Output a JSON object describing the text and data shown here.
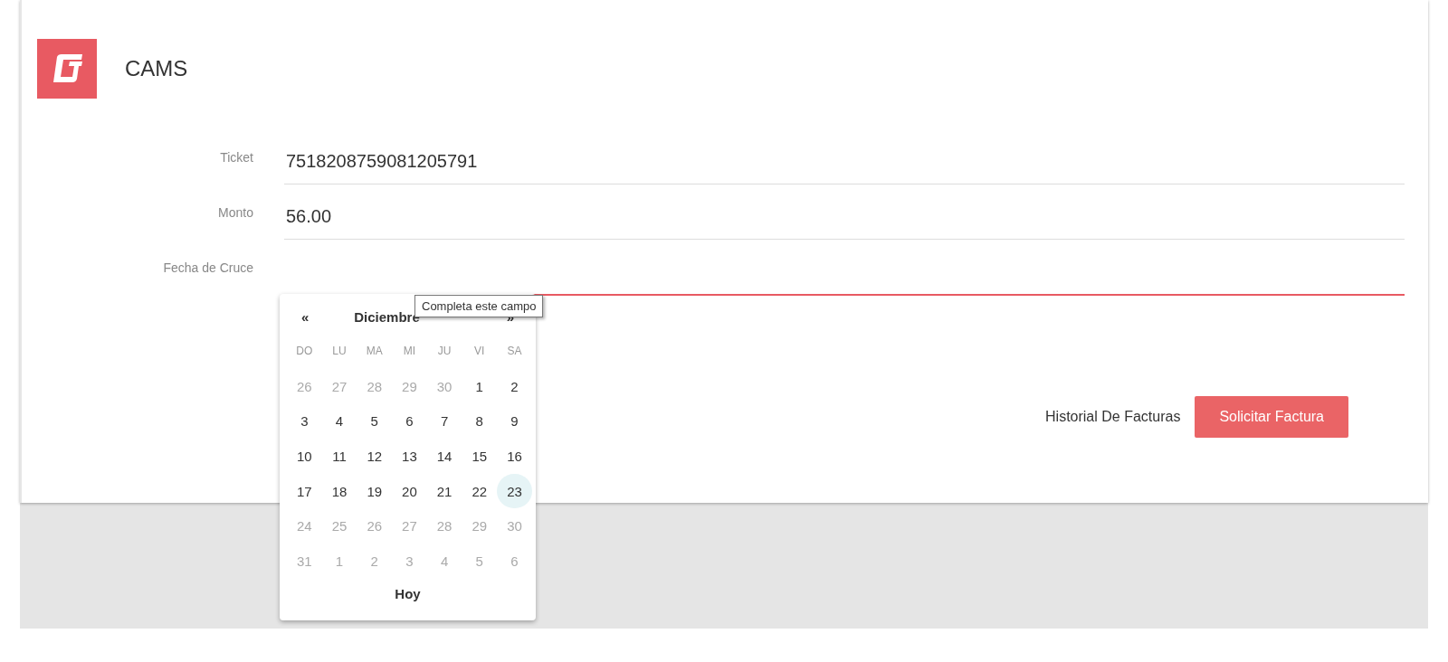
{
  "header": {
    "title": "CAMS"
  },
  "fields": [
    {
      "label": "Ticket",
      "value": "7518208759081205791",
      "invalid": false
    },
    {
      "label": "Monto",
      "value": "56.00",
      "invalid": false
    },
    {
      "label": "Fecha de Cruce",
      "invalid": true
    }
  ],
  "tooltip": "Completa este campo",
  "calendar": {
    "prev": "«",
    "title": "Diciembre",
    "next": "»",
    "weekdays": [
      "DO",
      "LU",
      "MA",
      "MI",
      "JU",
      "VI",
      "SA"
    ],
    "weeks": [
      [
        {
          "day": "26",
          "muted": true,
          "selected": false
        },
        {
          "day": "27",
          "muted": true,
          "selected": false
        },
        {
          "day": "28",
          "muted": true,
          "selected": false
        },
        {
          "day": "29",
          "muted": true,
          "selected": false
        },
        {
          "day": "30",
          "muted": true,
          "selected": false
        },
        {
          "day": "1",
          "muted": false,
          "selected": false
        },
        {
          "day": "2",
          "muted": false,
          "selected": false
        }
      ],
      [
        {
          "day": "3",
          "muted": false,
          "selected": false
        },
        {
          "day": "4",
          "muted": false,
          "selected": false
        },
        {
          "day": "5",
          "muted": false,
          "selected": false
        },
        {
          "day": "6",
          "muted": false,
          "selected": false
        },
        {
          "day": "7",
          "muted": false,
          "selected": false
        },
        {
          "day": "8",
          "muted": false,
          "selected": false
        },
        {
          "day": "9",
          "muted": false,
          "selected": false
        }
      ],
      [
        {
          "day": "10",
          "muted": false,
          "selected": false
        },
        {
          "day": "11",
          "muted": false,
          "selected": false
        },
        {
          "day": "12",
          "muted": false,
          "selected": false
        },
        {
          "day": "13",
          "muted": false,
          "selected": false
        },
        {
          "day": "14",
          "muted": false,
          "selected": false
        },
        {
          "day": "15",
          "muted": false,
          "selected": false
        },
        {
          "day": "16",
          "muted": false,
          "selected": false
        }
      ],
      [
        {
          "day": "17",
          "muted": false,
          "selected": false
        },
        {
          "day": "18",
          "muted": false,
          "selected": false
        },
        {
          "day": "19",
          "muted": false,
          "selected": false
        },
        {
          "day": "20",
          "muted": false,
          "selected": false
        },
        {
          "day": "21",
          "muted": false,
          "selected": false
        },
        {
          "day": "22",
          "muted": false,
          "selected": false
        },
        {
          "day": "23",
          "muted": false,
          "selected": true
        }
      ],
      [
        {
          "day": "24",
          "muted": true,
          "selected": false
        },
        {
          "day": "25",
          "muted": true,
          "selected": false
        },
        {
          "day": "26",
          "muted": true,
          "selected": false
        },
        {
          "day": "27",
          "muted": true,
          "selected": false
        },
        {
          "day": "28",
          "muted": true,
          "selected": false
        },
        {
          "day": "29",
          "muted": true,
          "selected": false
        },
        {
          "day": "30",
          "muted": true,
          "selected": false
        }
      ],
      [
        {
          "day": "31",
          "muted": true,
          "selected": false
        },
        {
          "day": "1",
          "muted": true,
          "selected": false
        },
        {
          "day": "2",
          "muted": true,
          "selected": false
        },
        {
          "day": "3",
          "muted": true,
          "selected": false
        },
        {
          "day": "4",
          "muted": true,
          "selected": false
        },
        {
          "day": "5",
          "muted": true,
          "selected": false
        },
        {
          "day": "6",
          "muted": true,
          "selected": false
        }
      ]
    ],
    "today": "Hoy"
  },
  "actions": {
    "history": "Historial De Facturas",
    "submit": "Solicitar Factura"
  }
}
